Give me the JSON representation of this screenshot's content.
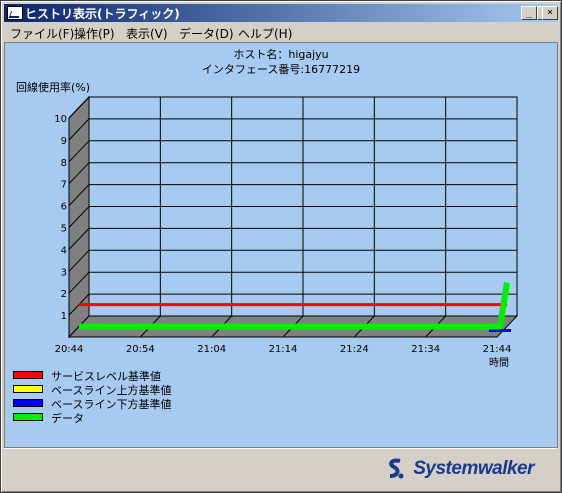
{
  "window": {
    "title": "ヒストリ表示(トラフィック)",
    "minimize": "_",
    "maximize": "□",
    "close": "×"
  },
  "menu": [
    {
      "label": "ファイル(F)"
    },
    {
      "label": "操作(P)"
    },
    {
      "label": "表示(V)"
    },
    {
      "label": "データ(D)"
    },
    {
      "label": "ヘルプ(H)"
    }
  ],
  "header": {
    "host": "ホスト名：higajyu",
    "interface": "インタフェース番号:16777219"
  },
  "brand": "Systemwalker",
  "colors": {
    "service_level": "#ff0000",
    "baseline_upper": "#ffff00",
    "baseline_lower": "#0000ff",
    "data": "#00ee00"
  },
  "chart_data": {
    "type": "line",
    "ylabel": "回線使用率(%)",
    "xlabel": "時間",
    "ylim": [
      0,
      10
    ],
    "y_ticks": [
      "1",
      "2",
      "3",
      "4",
      "5",
      "6",
      "7",
      "8",
      "9",
      "10"
    ],
    "x_ticks": [
      "20:44",
      "20:54",
      "21:04",
      "21:14",
      "21:24",
      "21:34",
      "21:44"
    ],
    "legend": [
      "サービスレベル基準値",
      "ベースライン上方基準値",
      "ベースライン下方基準値",
      "データ"
    ],
    "series": [
      {
        "name": "サービスレベル基準値",
        "x": [
          "20:44",
          "21:44"
        ],
        "values": [
          1,
          1
        ]
      },
      {
        "name": "ベースライン下方基準値",
        "x": [
          "21:44"
        ],
        "values": [
          0
        ]
      },
      {
        "name": "データ",
        "x": [
          "20:44",
          "21:43",
          "21:44"
        ],
        "values": [
          0,
          0,
          2
        ]
      }
    ]
  }
}
